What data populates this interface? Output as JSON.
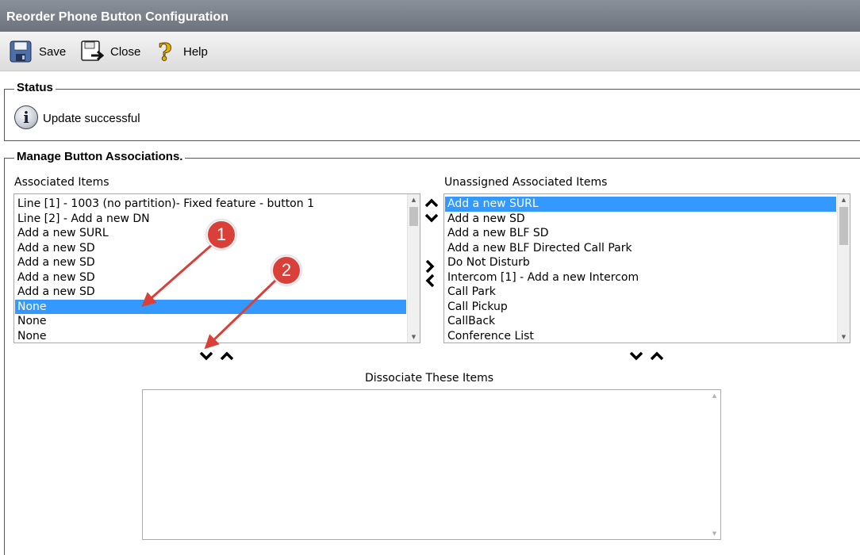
{
  "window": {
    "title": "Reorder Phone Button Configuration"
  },
  "toolbar": {
    "save_label": "Save",
    "close_label": "Close",
    "help_label": "Help"
  },
  "status": {
    "legend": "Status",
    "message": "Update successful",
    "icon": "info-icon"
  },
  "manage": {
    "legend": "Manage Button Associations."
  },
  "associated": {
    "label": "Associated Items",
    "items": [
      "Line [1] - 1003 (no partition)- Fixed feature - button 1",
      "Line [2] - Add a new DN",
      "Add a new SURL",
      "Add a new SD",
      "Add a new SD",
      "Add a new SD",
      "Add a new SD",
      "None",
      "None",
      "None"
    ],
    "selected_index": 7
  },
  "unassigned": {
    "label": "Unassigned Associated Items",
    "items": [
      "Add a new SURL",
      "Add a new SD",
      "Add a new BLF SD",
      "Add a new BLF Directed Call Park",
      "Do Not Disturb",
      "Intercom [1] - Add a new Intercom",
      "Call Park",
      "Call Pickup",
      "CallBack",
      "Conference List"
    ],
    "selected_index": 0
  },
  "dissociate": {
    "label": "Dissociate These Items",
    "items": []
  },
  "annotations": [
    {
      "number": "1",
      "color": "#d9403a"
    },
    {
      "number": "2",
      "color": "#d9403a"
    }
  ],
  "colors": {
    "selection": "#3399ff",
    "titlebar": "#7a8089"
  }
}
